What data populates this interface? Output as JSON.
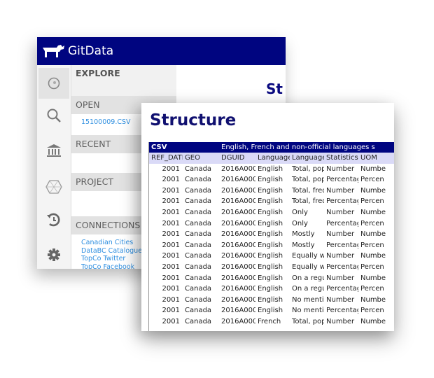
{
  "back_window": {
    "app_title": "GitData",
    "partial_title": "St",
    "sections": {
      "explore": "EXPLORE",
      "open": "OPEN",
      "open_files": [
        "15100009.CSV"
      ],
      "recent": "RECENT",
      "project": "PROJECT",
      "connections": "CONNECTIONS",
      "connection_items": [
        "Canadian Cities",
        "DataBC Catalogue",
        "TopCo Twitter",
        "TopCo Facebook"
      ]
    },
    "icons": [
      "explore-icon",
      "search-icon",
      "library-icon",
      "network-icon",
      "history-icon",
      "settings-icon"
    ]
  },
  "front_window": {
    "title": "Structure",
    "csv_label": "CSV",
    "csv_description": "English, French and non-official languages s",
    "columns": [
      "REF_DATE",
      "GEO",
      "DGUID",
      "Language",
      "Language",
      "Statistics",
      "UOM"
    ],
    "rows": [
      [
        "2001",
        "Canada",
        "2016A000",
        "English",
        "Total, pop",
        "Number",
        "Numbe"
      ],
      [
        "2001",
        "Canada",
        "2016A000",
        "English",
        "Total, pop",
        "Percentag",
        "Percen"
      ],
      [
        "2001",
        "Canada",
        "2016A000",
        "English",
        "Total, freq",
        "Number",
        "Numbe"
      ],
      [
        "2001",
        "Canada",
        "2016A000",
        "English",
        "Total, freq",
        "Percentag",
        "Percen"
      ],
      [
        "2001",
        "Canada",
        "2016A000",
        "English",
        "Only",
        "Number",
        "Numbe"
      ],
      [
        "2001",
        "Canada",
        "2016A000",
        "English",
        "Only",
        "Percentag",
        "Percen"
      ],
      [
        "2001",
        "Canada",
        "2016A000",
        "English",
        "Mostly",
        "Number",
        "Numbe"
      ],
      [
        "2001",
        "Canada",
        "2016A000",
        "English",
        "Mostly",
        "Percentag",
        "Percen"
      ],
      [
        "2001",
        "Canada",
        "2016A000",
        "English",
        "Equally w",
        "Number",
        "Numbe"
      ],
      [
        "2001",
        "Canada",
        "2016A000",
        "English",
        "Equally w",
        "Percentag",
        "Percen"
      ],
      [
        "2001",
        "Canada",
        "2016A000",
        "English",
        "On a regu",
        "Number",
        "Numbe"
      ],
      [
        "2001",
        "Canada",
        "2016A000",
        "English",
        "On a regu",
        "Percentag",
        "Percen"
      ],
      [
        "2001",
        "Canada",
        "2016A000",
        "English",
        "No mentic",
        "Number",
        "Numbe"
      ],
      [
        "2001",
        "Canada",
        "2016A000",
        "English",
        "No mentic",
        "Percentag",
        "Percen"
      ],
      [
        "2001",
        "Canada",
        "2016A000",
        "French",
        "Total, pop",
        "Number",
        "Numbe"
      ]
    ]
  },
  "colors": {
    "brand_navy": "#000580",
    "header_row": "#dadaf7",
    "link": "#2f8fe0",
    "title": "#101070"
  }
}
